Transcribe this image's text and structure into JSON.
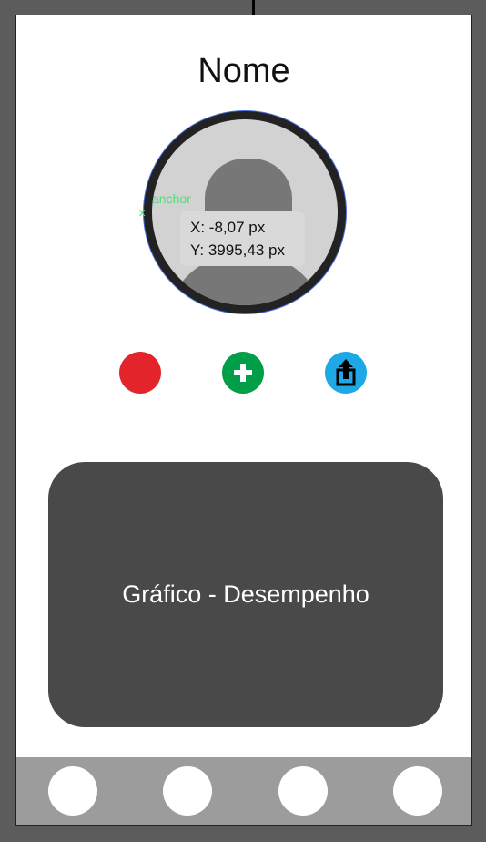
{
  "header": {
    "title": "Nome"
  },
  "profile": {
    "avatar_icon": "user-silhouette-icon",
    "anchor_label": "anchor",
    "anchor_marker": "x"
  },
  "coordinates": {
    "x_text": "X: -8,07 px",
    "y_text": "Y: 3995,43 px"
  },
  "actions": [
    {
      "icon": "red-circle-icon",
      "color": "#e3242b"
    },
    {
      "icon": "plus-icon",
      "color": "#009e48"
    },
    {
      "icon": "share-upload-icon",
      "color": "#1ea8e6"
    }
  ],
  "chart_card": {
    "label": "Gráfico - Desempenho"
  },
  "bottom_nav": {
    "items": [
      {
        "icon": "nav-circle-icon"
      },
      {
        "icon": "nav-circle-icon"
      },
      {
        "icon": "nav-circle-icon"
      },
      {
        "icon": "nav-circle-icon"
      }
    ]
  }
}
